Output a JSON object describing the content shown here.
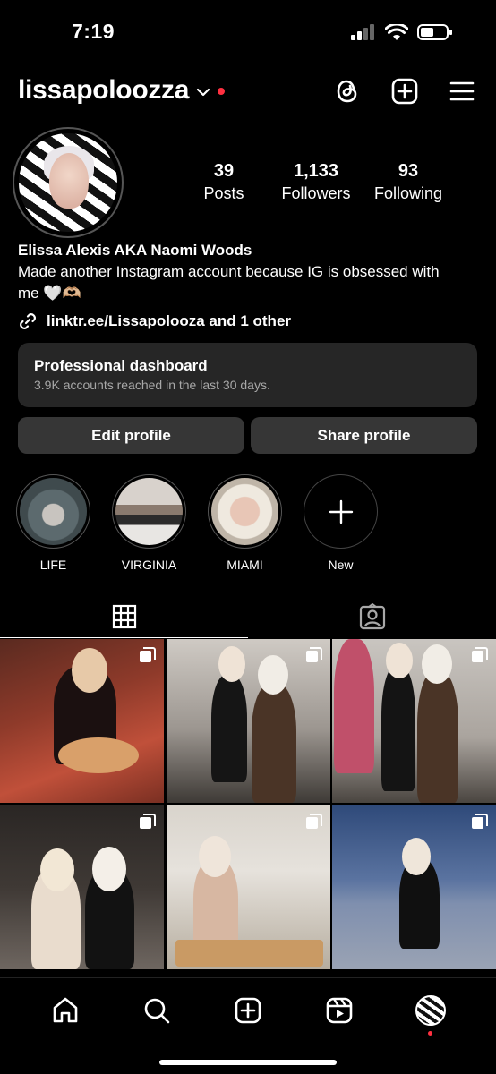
{
  "status_bar": {
    "time": "7:19"
  },
  "header": {
    "username": "lissapoloozza"
  },
  "profile": {
    "stats": [
      {
        "value": "39",
        "label": "Posts"
      },
      {
        "value": "1,133",
        "label": "Followers"
      },
      {
        "value": "93",
        "label": "Following"
      }
    ],
    "name": "Elissa Alexis AKA Naomi Woods",
    "bio": "Made another Instagram account because IG is obsessed with me 🤍🫶🏼",
    "link": "linktr.ee/Lissapolooza and 1 other"
  },
  "dashboard": {
    "title": "Professional dashboard",
    "subtitle": "3.9K accounts reached in the last 30 days."
  },
  "buttons": {
    "edit": "Edit profile",
    "share": "Share profile"
  },
  "highlights": [
    {
      "label": "LIFE"
    },
    {
      "label": "VIRGINIA"
    },
    {
      "label": "MIAMI"
    },
    {
      "label": "New"
    }
  ],
  "colors": {
    "background": "#000000",
    "button": "#363636",
    "card": "#262626",
    "notification": "#ff3040"
  }
}
